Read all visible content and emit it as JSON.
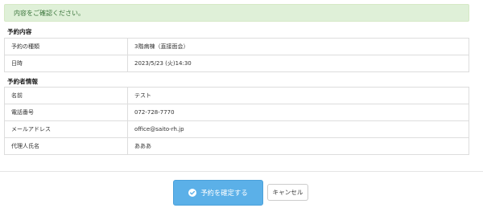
{
  "alert": {
    "message": "内容をご確認ください。"
  },
  "reservation": {
    "title": "予約内容",
    "rows": [
      {
        "label": "予約の種類",
        "value": "3階病棟（直接面会）"
      },
      {
        "label": "日時",
        "value": "2023/5/23 (火)14:30"
      }
    ]
  },
  "reserver": {
    "title": "予約者情報",
    "rows": [
      {
        "label": "名前",
        "value": "テスト"
      },
      {
        "label": "電話番号",
        "value": "072-728-7770"
      },
      {
        "label": "メールアドレス",
        "value": "office@saito-rh.jp"
      },
      {
        "label": "代理人氏名",
        "value": "あああ"
      }
    ]
  },
  "actions": {
    "confirm_label": "予約を確定する",
    "confirm_icon": "check-circle-icon",
    "cancel_label": "キャンセル"
  },
  "colors": {
    "alert_bg": "#dff0d8",
    "alert_text": "#3c763d",
    "primary": "#5bb0e8"
  }
}
